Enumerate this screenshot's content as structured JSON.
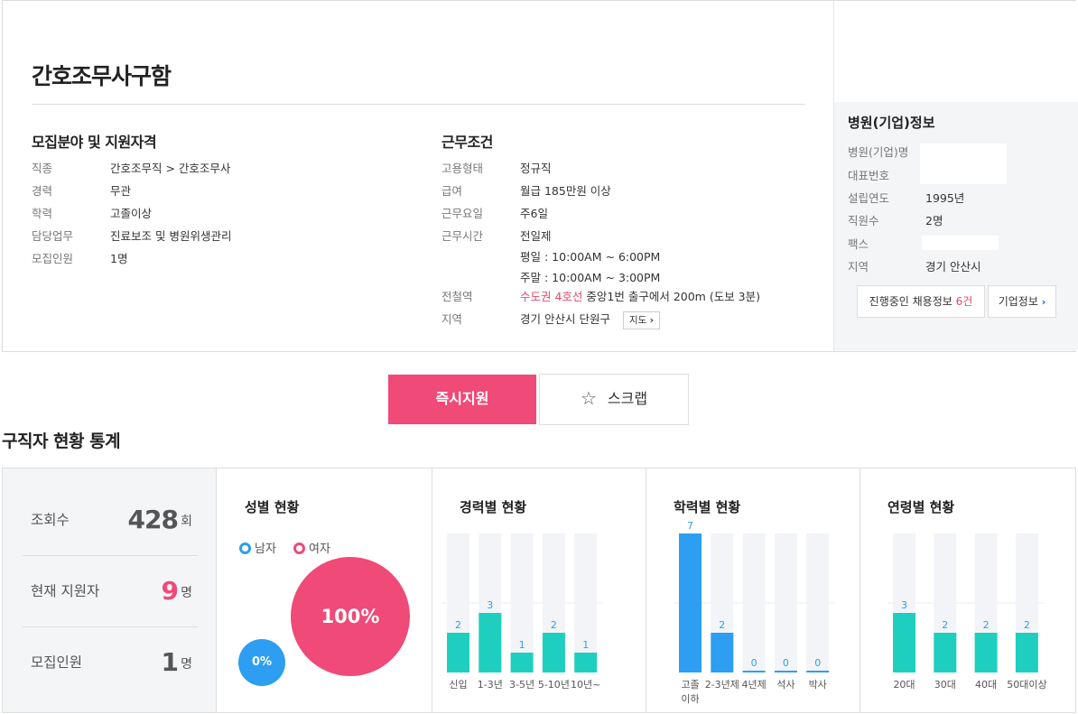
{
  "job": {
    "title": "간호조무사구함",
    "qualification": {
      "title": "모집분야 및 지원자격",
      "rows": [
        {
          "key": "직종",
          "value": "간호조무직 > 간호조무사",
          "link": false
        },
        {
          "key": "경력",
          "value": "무관",
          "link": true
        },
        {
          "key": "학력",
          "value": "고졸이상",
          "link": true
        },
        {
          "key": "담당업무",
          "value": "진료보조 및 병원위생관리",
          "link": false
        },
        {
          "key": "모집인원",
          "value": "1명",
          "link": false
        }
      ]
    },
    "conditions": {
      "title": "근무조건",
      "employment_type_key": "고용형태",
      "employment_type": "정규직",
      "salary_key": "급여",
      "salary": "월급 185만원 이상",
      "days_key": "근무요일",
      "days": "주6일",
      "hours_key": "근무시간",
      "hours_line1": "전일제",
      "hours_line2": "평일 : 10:00AM ~ 6:00PM",
      "hours_line3": "주말 : 10:00AM ~ 3:00PM",
      "subway_key": "전철역",
      "subway_line": "수도권 4호선",
      "subway_detail": "중앙1번 출구에서 200m (도보 3분)",
      "region_key": "지역",
      "region": "경기 안산시 단원구",
      "map_button": "지도"
    }
  },
  "company": {
    "title": "병원(기업)정보",
    "name_key": "병원(기업)명",
    "name": "",
    "phone_key": "대표번호",
    "phone": "",
    "founded_key": "설립연도",
    "founded": "1995년",
    "employees_key": "직원수",
    "employees": "2명",
    "fax_key": "팩스",
    "fax": "",
    "region_key": "지역",
    "region": "경기 안산시",
    "jobs_button_prefix": "진행중인 채용정보",
    "jobs_button_count": "6건",
    "info_button": "기업정보"
  },
  "actions": {
    "apply": "즉시지원",
    "scrap": "스크랩"
  },
  "stats": {
    "title": "구직자 현황 통계",
    "summary": [
      {
        "label": "조회수",
        "value": "428",
        "unit": "회",
        "color": "#555555"
      },
      {
        "label": "현재 지원자",
        "value": "9",
        "unit": "명",
        "color": "#ef4a78"
      },
      {
        "label": "모집인원",
        "value": "1",
        "unit": "명",
        "color": "#555555"
      }
    ],
    "gender": {
      "title": "성별 현황",
      "male_label": "남자",
      "female_label": "여자",
      "male_pct": "0%",
      "female_pct": "100%",
      "male_color": "#2d9ef1",
      "female_color": "#ef4a78"
    }
  },
  "chart_data": [
    {
      "type": "bar",
      "title": "경력별 현황",
      "categories": [
        "신입",
        "1-3년",
        "3-5년",
        "5-10년",
        "10년~"
      ],
      "values": [
        2,
        3,
        1,
        2,
        1
      ],
      "ylim": [
        0,
        7
      ],
      "highlight": [],
      "color": "#1ecfc0"
    },
    {
      "type": "bar",
      "title": "학력별 현황",
      "categories": [
        "고졸 이하",
        "2-3년제",
        "4년제",
        "석사",
        "박사"
      ],
      "values": [
        7,
        2,
        0,
        0,
        0
      ],
      "ylim": [
        0,
        7
      ],
      "highlight": [
        0
      ],
      "color": "#2d9ef1"
    },
    {
      "type": "bar",
      "title": "연령별 현황",
      "categories": [
        "20대",
        "30대",
        "40대",
        "50대이상"
      ],
      "values": [
        3,
        2,
        2,
        2
      ],
      "ylim": [
        0,
        7
      ],
      "highlight": [],
      "color": "#1ecfc0"
    }
  ]
}
